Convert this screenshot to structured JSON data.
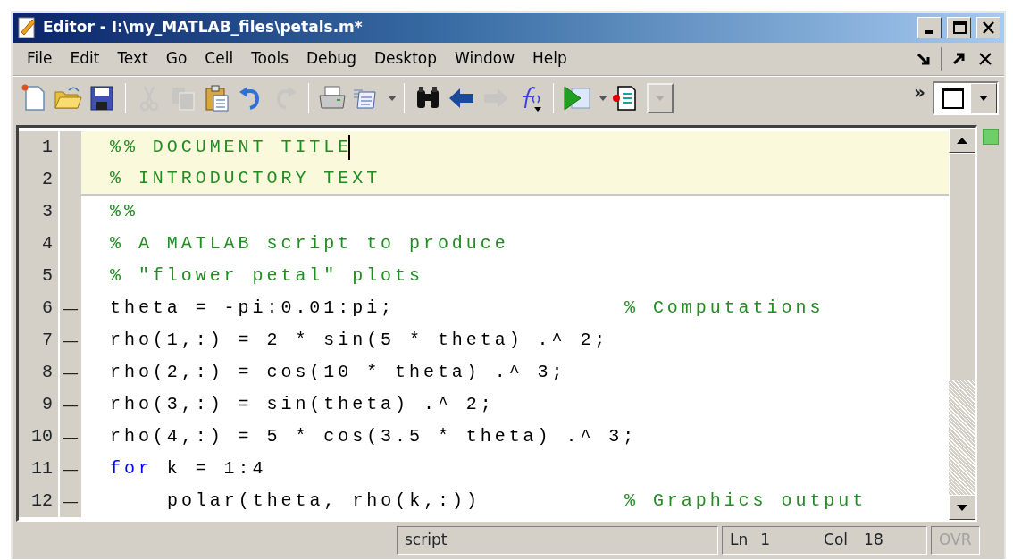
{
  "window": {
    "title": "Editor - I:\\my_MATLAB_files\\petals.m*"
  },
  "menu": [
    "File",
    "Edit",
    "Text",
    "Go",
    "Cell",
    "Tools",
    "Debug",
    "Desktop",
    "Window",
    "Help"
  ],
  "toolbar": [
    {
      "kind": "button",
      "disabled": false
    },
    {
      "kind": "button",
      "disabled": false
    },
    {
      "kind": "button",
      "disabled": false
    },
    {
      "kind": "separator"
    },
    {
      "kind": "button",
      "disabled": true
    },
    {
      "kind": "button",
      "disabled": true
    },
    {
      "kind": "button",
      "disabled": false
    },
    {
      "kind": "button",
      "disabled": false
    },
    {
      "kind": "button",
      "disabled": true
    },
    {
      "kind": "separator"
    },
    {
      "kind": "button",
      "disabled": false
    },
    {
      "kind": "split",
      "disabled": false
    },
    {
      "kind": "separator"
    },
    {
      "kind": "button",
      "disabled": false
    },
    {
      "kind": "button",
      "disabled": false
    },
    {
      "kind": "button",
      "disabled": true
    },
    {
      "kind": "button",
      "disabled": false
    },
    {
      "kind": "separator"
    },
    {
      "kind": "split",
      "disabled": false
    },
    {
      "kind": "button",
      "disabled": false
    },
    {
      "kind": "combo",
      "disabled": true
    }
  ],
  "overflow": "»",
  "lines": [
    {
      "number": "1",
      "cell_title": true,
      "cursor": true,
      "segments": [
        {
          "kind": "comment",
          "text": "%% DOCUMENT TITLE"
        }
      ]
    },
    {
      "number": "2",
      "cell_title": true,
      "cursor": false,
      "segments": [
        {
          "kind": "comment",
          "text": "% INTRODUCTORY TEXT"
        }
      ]
    },
    {
      "number": "3",
      "cell_title": false,
      "cursor": false,
      "segments": [
        {
          "kind": "comment",
          "text": "%%"
        }
      ]
    },
    {
      "number": "4",
      "cell_title": false,
      "cursor": false,
      "segments": [
        {
          "kind": "comment",
          "text": "% A MATLAB script to produce"
        }
      ]
    },
    {
      "number": "5",
      "cell_title": false,
      "cursor": false,
      "segments": [
        {
          "kind": "comment",
          "text": "% \"flower petal\" plots"
        }
      ]
    },
    {
      "number": "6",
      "marker": "—",
      "cell_title": false,
      "cursor": false,
      "segments": [
        {
          "kind": "code",
          "text": "theta = -pi:0.01:pi;"
        },
        {
          "kind": "trailing_comment",
          "text": "% Computations"
        }
      ]
    },
    {
      "number": "7",
      "marker": "—",
      "cell_title": false,
      "cursor": false,
      "segments": [
        {
          "kind": "code",
          "text": "rho(1,:) = 2 * sin(5 * theta) .^ 2;"
        }
      ]
    },
    {
      "number": "8",
      "marker": "—",
      "cell_title": false,
      "cursor": false,
      "segments": [
        {
          "kind": "code",
          "text": "rho(2,:) = cos(10 * theta) .^ 3;"
        }
      ]
    },
    {
      "number": "9",
      "marker": "—",
      "cell_title": false,
      "cursor": false,
      "segments": [
        {
          "kind": "code",
          "text": "rho(3,:) = sin(theta) .^ 2;"
        }
      ]
    },
    {
      "number": "10",
      "marker": "—",
      "cell_title": false,
      "cursor": false,
      "segments": [
        {
          "kind": "code",
          "text": "rho(4,:) = 5 * cos(3.5 * theta) .^ 3;"
        }
      ]
    },
    {
      "number": "11",
      "marker": "—",
      "cell_title": false,
      "cursor": false,
      "segments": [
        {
          "kind": "keyword",
          "text": "for"
        },
        {
          "kind": "code",
          "text": " k = 1:4"
        }
      ],
      "children": [
        {
          "number": "12",
          "marker": "—",
          "cell_title": false,
          "cursor": false,
          "segments": [
            {
              "kind": "code",
              "text": "polar(theta, rho(k,:))"
            },
            {
              "kind": "trailing_comment",
              "text": "% Graphics output"
            }
          ]
        }
      ]
    }
  ],
  "status_bar": {
    "mode": "script",
    "line_label": "Ln",
    "line": "1",
    "col_label": "Col",
    "col": "18",
    "ovr": {
      "text": "OVR",
      "disabled": true
    }
  }
}
